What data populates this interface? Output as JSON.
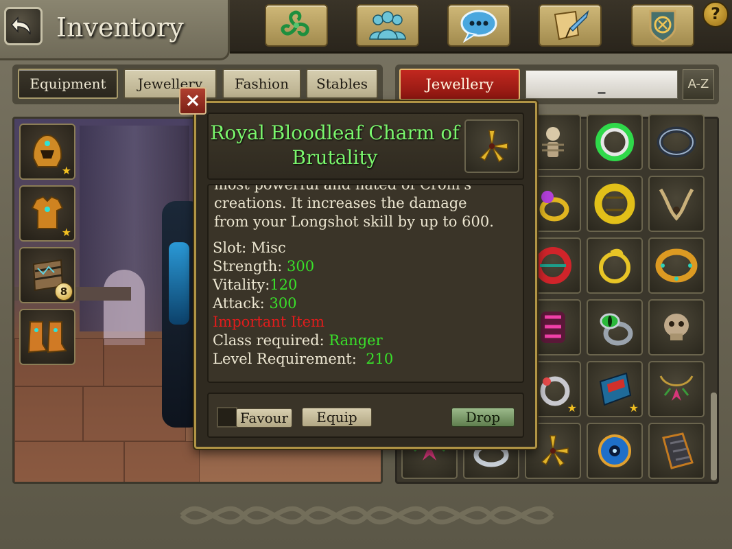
{
  "header": {
    "title": "Inventory",
    "help_label": "?"
  },
  "topbar_icons": [
    "triskele-icon",
    "party-icon",
    "chat-icon",
    "quest-scroll-icon",
    "guild-shield-icon"
  ],
  "tabs": [
    {
      "label": "Equipment",
      "active": true
    },
    {
      "label": "Jewellery",
      "active": false
    },
    {
      "label": "Fashion",
      "active": false
    },
    {
      "label": "Stables",
      "active": false
    }
  ],
  "filter": {
    "category": "Jewellery",
    "search_value": "_",
    "sort_label": "A-Z"
  },
  "equipment_slots": [
    {
      "icon": "helmet-icon",
      "starred": true
    },
    {
      "icon": "chest-armor-icon",
      "starred": true
    },
    {
      "icon": "bracer-icon",
      "badge": "8"
    },
    {
      "icon": "boots-icon",
      "starred": false
    }
  ],
  "inventory_items": [
    [
      "skeleton-icon",
      "ornate-green-ring-icon",
      "dark-runed-ring-icon"
    ],
    [
      "purple-gem-ring-icon",
      "gold-engraved-ring-icon",
      "twisted-amulet-icon"
    ],
    [
      "red-banded-ring-icon",
      "gold-coil-ring-icon",
      "gold-gem-band-icon"
    ],
    [
      "pink-gem-bracelet-icon",
      "green-eye-ring-icon",
      "skull-ring-icon"
    ],
    [
      "silver-ring-icon",
      "blue-red-bracer-icon",
      "flower-necklace-icon"
    ],
    [
      "flower-charm-icon",
      "silver-band-icon",
      "bloodleaf-charm-icon",
      "blue-eye-amulet-icon",
      "scaled-bracer-icon"
    ]
  ],
  "tooltip": {
    "title": "Royal Bloodleaf Charm of Brutality",
    "description_partial": "most powerful and hated of Crom's",
    "description_lines": [
      "creations. It increases the damage",
      "from your Longshot skill by up to 600."
    ],
    "stats": {
      "slot_label": "Slot:",
      "slot_value": "Misc",
      "strength_label": "Strength:",
      "strength_value": "300",
      "vitality_label": "Vitality:",
      "vitality_value": "120",
      "attack_label": "Attack:",
      "attack_value": "300",
      "important_label": "Important Item",
      "class_label": "Class required:",
      "class_value": "Ranger",
      "level_label": "Level Requirement:",
      "level_value": "210"
    },
    "buttons": {
      "favour": "Favour",
      "equip": "Equip",
      "drop": "Drop",
      "close": "×"
    }
  }
}
